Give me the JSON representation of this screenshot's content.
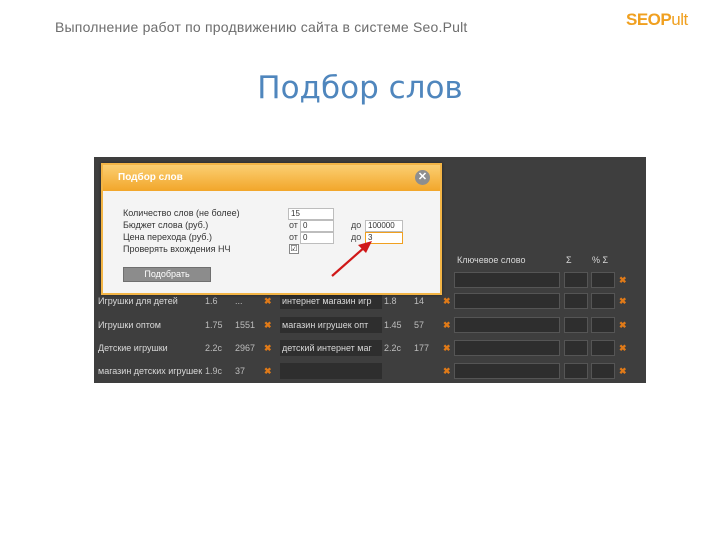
{
  "slide": {
    "header": "Выполнение работ по продвижению сайта в системе Seo.Pult",
    "logo_main": "SEOP",
    "logo_rest": "ult",
    "title": "Подбор слов"
  },
  "background_table": {
    "header_phrase": "Ключевое слово",
    "header_col1": "Σ",
    "header_col2": "% Σ",
    "rows": [
      {
        "phrase": "",
        "n1": "",
        "n2": "",
        "phrase2": "",
        "n3": "",
        "n4": ""
      },
      {
        "phrase": "Игрушки для детей",
        "n1": "1.6",
        "n2": "...",
        "phrase2": "интернет магазин игр",
        "n3": "1.8",
        "n4": "14"
      },
      {
        "phrase": "Игрушки оптом",
        "n1": "1.75",
        "n2": "1551",
        "phrase2": "магазин игрушек опт",
        "n3": "1.45",
        "n4": "57"
      },
      {
        "phrase": "Детские игрушки",
        "n1": "2.2с",
        "n2": "2967",
        "phrase2": "детский интернет маг",
        "n3": "2.2с",
        "n4": "177"
      },
      {
        "phrase": "магазин детских игрушек",
        "n1": "1.9с",
        "n2": "37",
        "phrase2": "",
        "n3": "",
        "n4": ""
      }
    ],
    "remove_glyph": "✖"
  },
  "dialog": {
    "title": "Подбор слов",
    "close_glyph": "✕",
    "fields": [
      {
        "label": "Количество слов (не более)",
        "value": ""
      },
      {
        "label": "Бюджет слова (руб.)",
        "from_prefix": "от",
        "from_value": "0",
        "to_prefix": "до",
        "to_value": "100000"
      },
      {
        "label": "Цена перехода (руб.)",
        "from_prefix": "от",
        "from_value": "0",
        "to_prefix": "до",
        "to_value": "3"
      },
      {
        "label": "Проверять вхождения НЧ",
        "checked": "☑"
      }
    ],
    "count_value": "15",
    "submit_label": "Подобрать"
  }
}
